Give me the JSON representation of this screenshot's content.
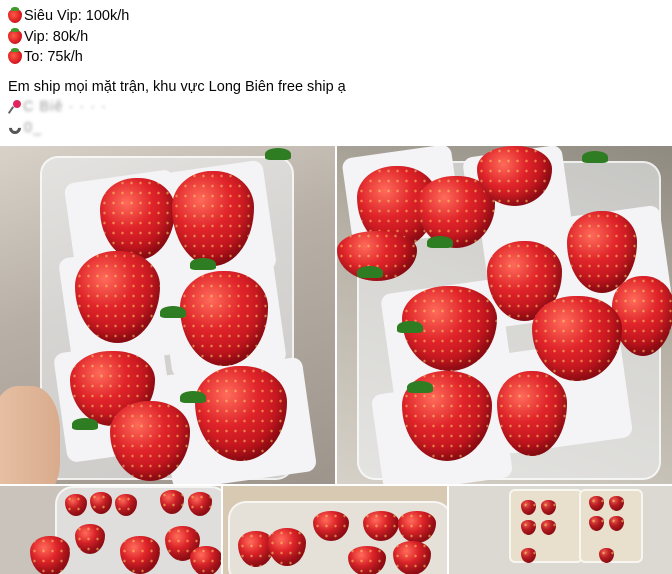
{
  "post": {
    "lines": [
      {
        "icon": "strawberry-icon",
        "text": "Siêu Vip: 100k/h"
      },
      {
        "icon": "strawberry-icon",
        "text": "Vip: 80k/h"
      },
      {
        "icon": "strawberry-icon",
        "text": "To: 75k/h"
      }
    ],
    "shipping": "Em ship mọi mặt trận, khu vực Long Biên free ship ạ",
    "address": "C    Biê    ·    ·  ·  ·    ",
    "phone": "0_"
  },
  "photos": [
    {
      "name": "strawberries-photo-1",
      "subject": "strawberries in clear plastic tray held by hand"
    },
    {
      "name": "strawberries-photo-2",
      "subject": "strawberries in tray on paper wrappers"
    },
    {
      "name": "strawberries-photo-3",
      "subject": "many strawberry trays"
    },
    {
      "name": "strawberries-photo-4",
      "subject": "strawberries in tray"
    },
    {
      "name": "strawberries-photo-5",
      "subject": "stacked strawberry boxes"
    }
  ],
  "colors": {
    "text": "#050505",
    "berry": "#d3121c",
    "leaf": "#2f7d22"
  }
}
